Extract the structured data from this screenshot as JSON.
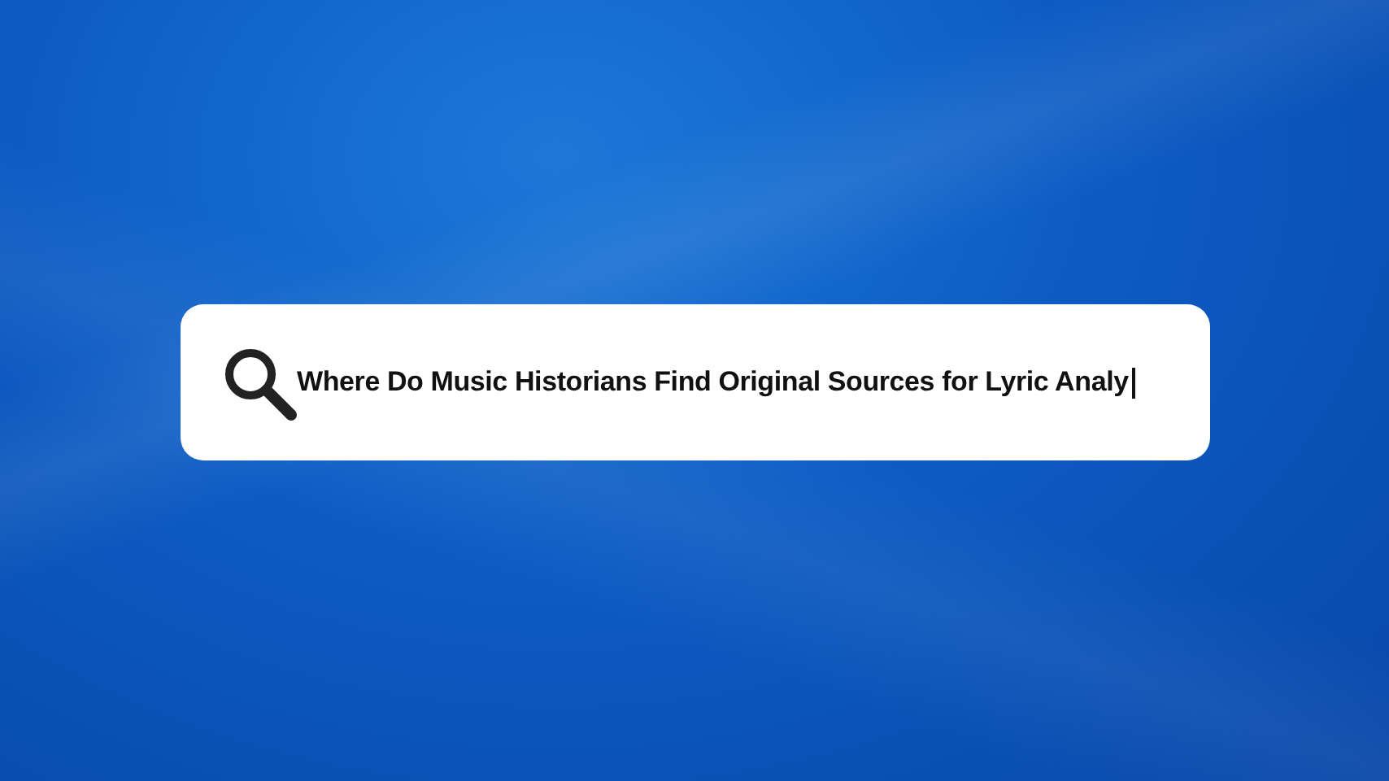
{
  "search": {
    "value": "Where Do Music Historians Find Original Sources for Lyric Analy",
    "focused": true
  }
}
